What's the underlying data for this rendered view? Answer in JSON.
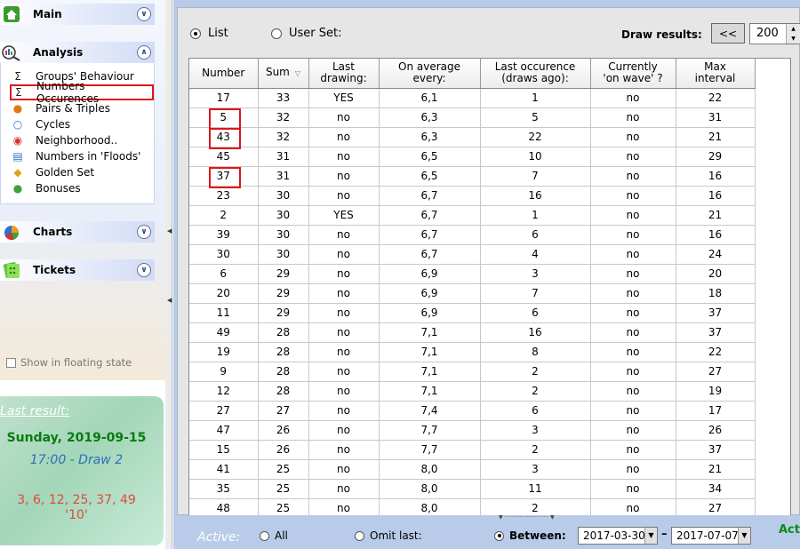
{
  "sidebar": {
    "sections": {
      "main": {
        "label": "Main"
      },
      "analysis": {
        "label": "Analysis"
      },
      "charts": {
        "label": "Charts"
      },
      "tickets": {
        "label": "Tickets"
      }
    },
    "analysis_items": [
      {
        "label": "Groups' Behaviour",
        "icon": "sigma-icon"
      },
      {
        "label": "Numbers Occurences",
        "icon": "sigma-alpha-icon",
        "highlighted": true
      },
      {
        "label": "Pairs & Triples",
        "icon": "pairs-icon"
      },
      {
        "label": "Cycles",
        "icon": "cycles-icon"
      },
      {
        "label": "Neighborhood..",
        "icon": "neighborhood-icon"
      },
      {
        "label": "Numbers in 'Floods'",
        "icon": "floods-icon"
      },
      {
        "label": "Golden Set",
        "icon": "golden-set-icon"
      },
      {
        "label": "Bonuses",
        "icon": "bonuses-icon"
      }
    ],
    "floating_label": "Show in floating state",
    "last_result": {
      "label": "Last result:",
      "date": "Sunday, 2019-09-15",
      "draw": "17:00 - Draw 2",
      "numbers": "3, 6, 12, 25, 37, 49",
      "bonus": "'10'"
    }
  },
  "toolbar": {
    "list_label": "List",
    "user_set_label": "User Set:",
    "draw_results_label": "Draw results:",
    "prev_label": "<<",
    "draw_count": "200"
  },
  "table": {
    "headers": [
      "Number",
      "Sum",
      "Last\ndrawing:",
      "On average\nevery:",
      "Last occurence\n(draws ago):",
      "Currently\n'on wave' ?",
      "Max\ninterval"
    ],
    "rows": [
      [
        "17",
        "33",
        "YES",
        "6,1",
        "1",
        "no",
        "22"
      ],
      [
        "5",
        "32",
        "no",
        "6,3",
        "5",
        "no",
        "31"
      ],
      [
        "43",
        "32",
        "no",
        "6,3",
        "22",
        "no",
        "21"
      ],
      [
        "45",
        "31",
        "no",
        "6,5",
        "10",
        "no",
        "29"
      ],
      [
        "37",
        "31",
        "no",
        "6,5",
        "7",
        "no",
        "16"
      ],
      [
        "23",
        "30",
        "no",
        "6,7",
        "16",
        "no",
        "16"
      ],
      [
        "2",
        "30",
        "YES",
        "6,7",
        "1",
        "no",
        "21"
      ],
      [
        "39",
        "30",
        "no",
        "6,7",
        "6",
        "no",
        "16"
      ],
      [
        "30",
        "30",
        "no",
        "6,7",
        "4",
        "no",
        "24"
      ],
      [
        "6",
        "29",
        "no",
        "6,9",
        "3",
        "no",
        "20"
      ],
      [
        "20",
        "29",
        "no",
        "6,9",
        "7",
        "no",
        "18"
      ],
      [
        "11",
        "29",
        "no",
        "6,9",
        "6",
        "no",
        "37"
      ],
      [
        "49",
        "28",
        "no",
        "7,1",
        "16",
        "no",
        "37"
      ],
      [
        "19",
        "28",
        "no",
        "7,1",
        "8",
        "no",
        "22"
      ],
      [
        "9",
        "28",
        "no",
        "7,1",
        "2",
        "no",
        "27"
      ],
      [
        "12",
        "28",
        "no",
        "7,1",
        "2",
        "no",
        "19"
      ],
      [
        "27",
        "27",
        "no",
        "7,4",
        "6",
        "no",
        "17"
      ],
      [
        "47",
        "26",
        "no",
        "7,7",
        "3",
        "no",
        "26"
      ],
      [
        "15",
        "26",
        "no",
        "7,7",
        "2",
        "no",
        "37"
      ],
      [
        "41",
        "25",
        "no",
        "8,0",
        "3",
        "no",
        "21"
      ],
      [
        "35",
        "25",
        "no",
        "8,0",
        "11",
        "no",
        "34"
      ],
      [
        "48",
        "25",
        "no",
        "8,0",
        "2",
        "no",
        "27"
      ]
    ],
    "highlighted_numbers": [
      "5",
      "43",
      "37"
    ]
  },
  "bottom": {
    "active_label": "Active:",
    "all_label": "All",
    "omit_last_label": "Omit last:",
    "between_label": "Between:",
    "date_from": "2017-03-30",
    "date_to": "2017-07-07",
    "truncated_label": "Act"
  }
}
